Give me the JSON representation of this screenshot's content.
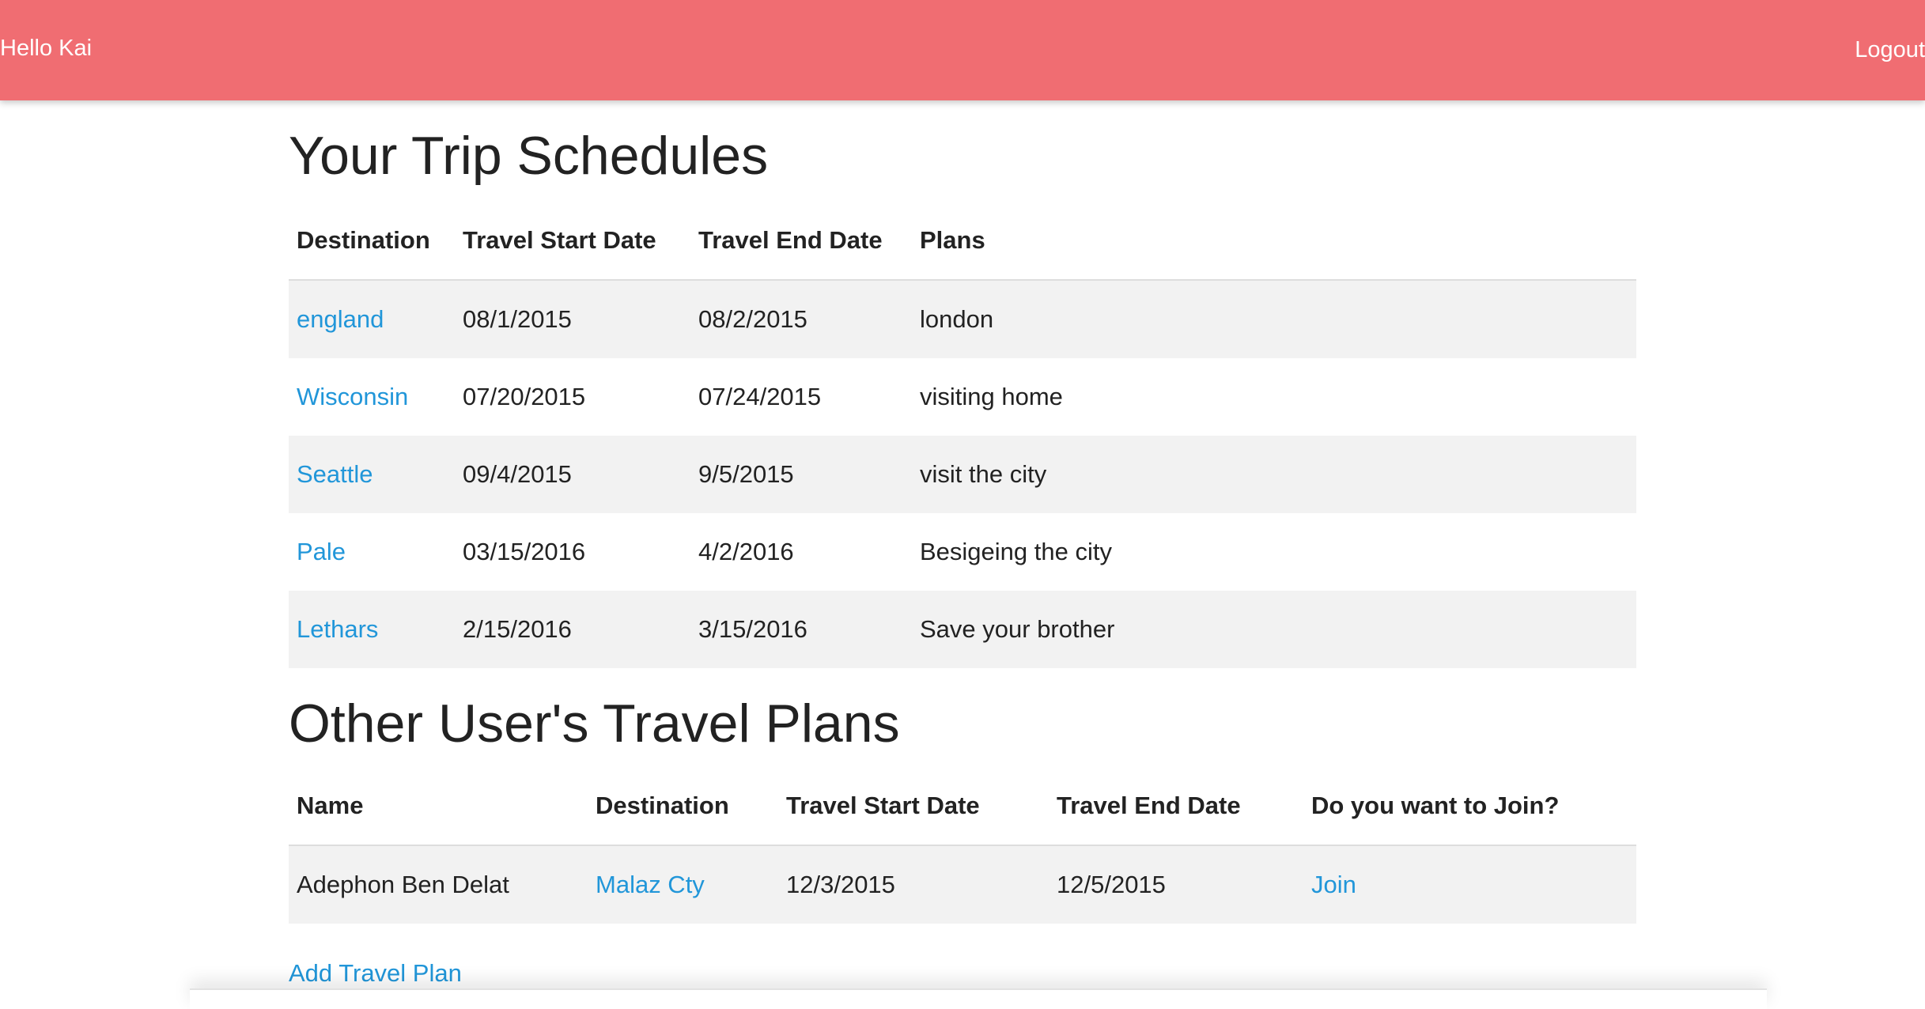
{
  "header": {
    "greeting": "Hello Kai",
    "logout_label": "Logout",
    "bg_color": "#f06d72"
  },
  "trips": {
    "title": "Your Trip Schedules",
    "columns": [
      "Destination",
      "Travel Start Date",
      "Travel End Date",
      "Plans"
    ],
    "rows": [
      {
        "destination": "england",
        "start": "08/1/2015",
        "end": "08/2/2015",
        "plans": "london"
      },
      {
        "destination": "Wisconsin",
        "start": "07/20/2015",
        "end": "07/24/2015",
        "plans": "visiting home"
      },
      {
        "destination": "Seattle",
        "start": "09/4/2015",
        "end": "9/5/2015",
        "plans": "visit the city"
      },
      {
        "destination": "Pale",
        "start": "03/15/2016",
        "end": "4/2/2016",
        "plans": "Besigeing the city"
      },
      {
        "destination": "Lethars",
        "start": "2/15/2016",
        "end": "3/15/2016",
        "plans": "Save your brother"
      }
    ]
  },
  "others": {
    "title": "Other User's Travel Plans",
    "columns": [
      "Name",
      "Destination",
      "Travel Start Date",
      "Travel End Date",
      "Do you want to Join?"
    ],
    "rows": [
      {
        "name": "Adephon Ben Delat",
        "destination": "Malaz Cty",
        "start": "12/3/2015",
        "end": "12/5/2015",
        "join": "Join"
      }
    ]
  },
  "footer": {
    "add_plan_label": "Add Travel Plan"
  },
  "colors": {
    "link": "#2196d9",
    "stripe": "#f2f2f2"
  }
}
